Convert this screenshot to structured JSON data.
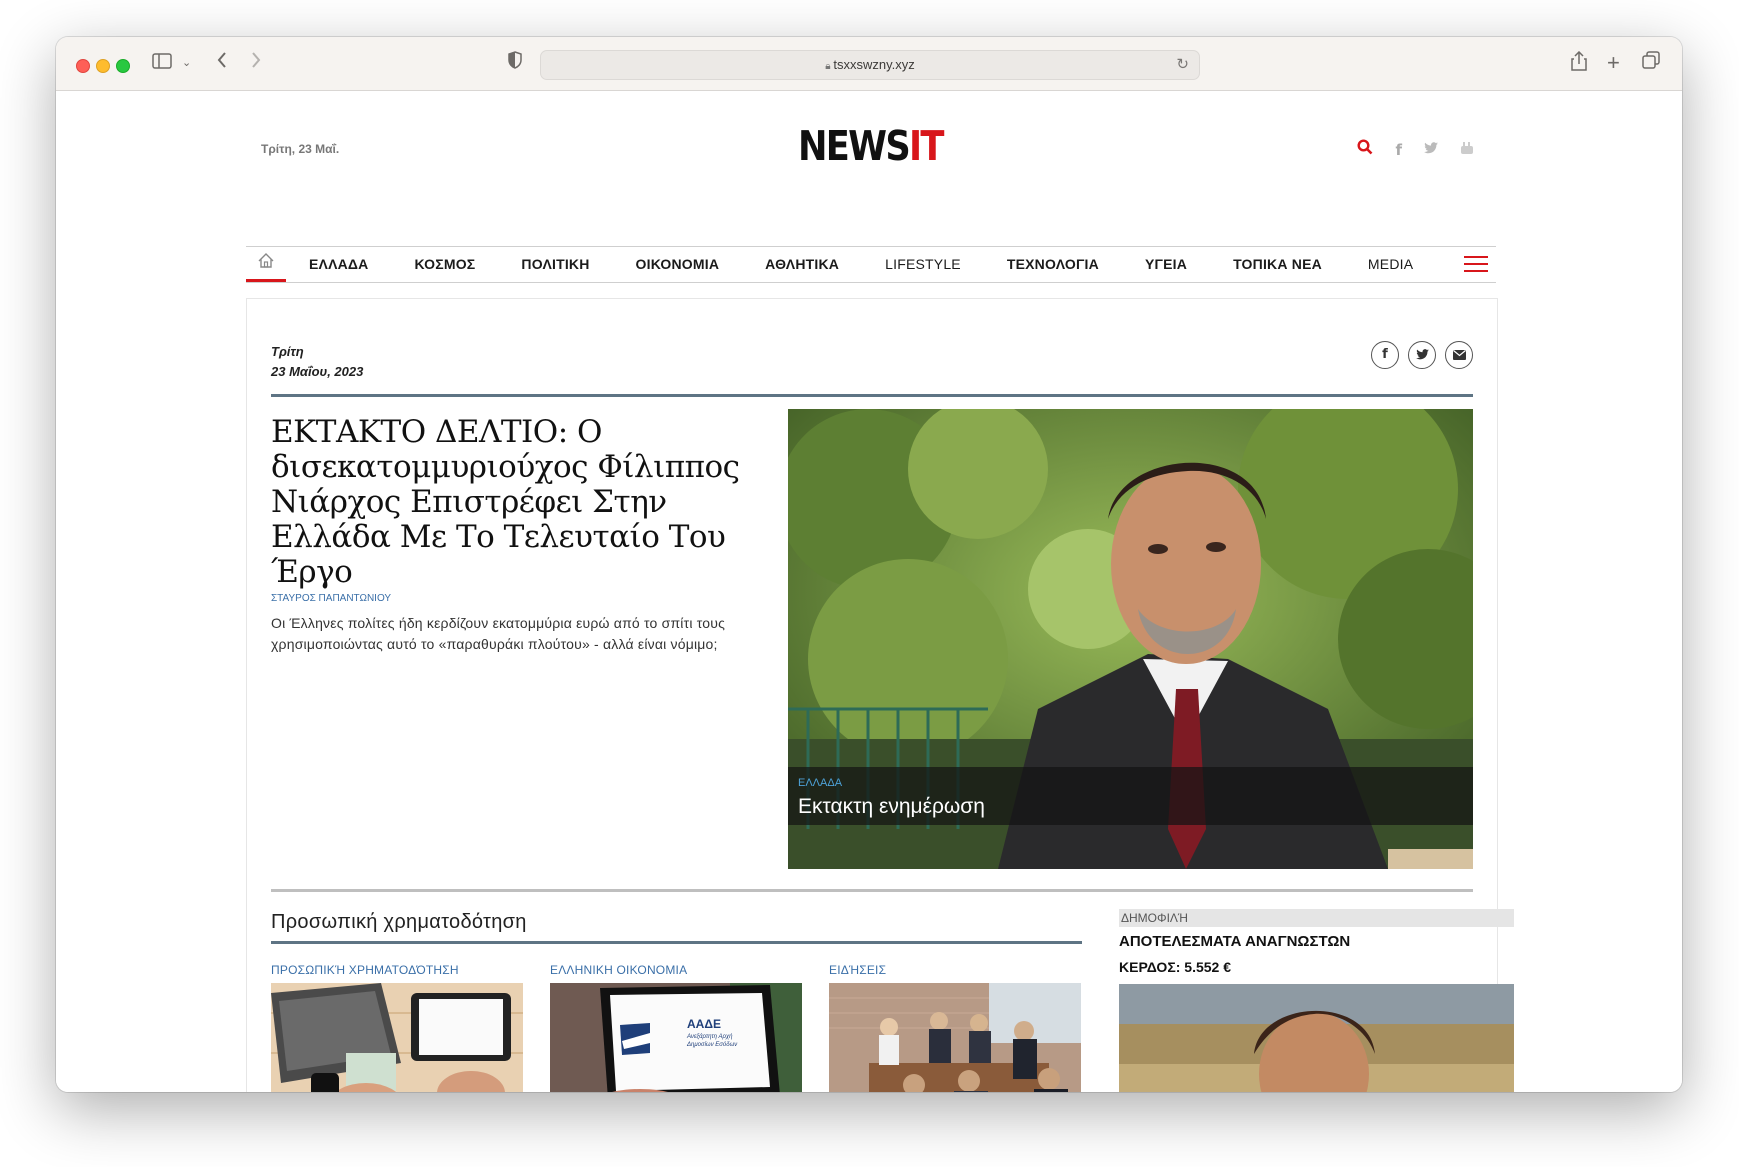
{
  "browser": {
    "url": "tsxxswzny.xyz"
  },
  "header": {
    "date": "Τρίτη, 23 Μαΐ.",
    "logo_news": "NEWS",
    "logo_it": "IT"
  },
  "nav": {
    "items": [
      "ΕΛΛΑΔΑ",
      "ΚΟΣΜΟΣ",
      "ΠΟΛΙΤΙΚΗ",
      "ΟΙΚΟΝΟΜΙΑ",
      "ΑΘΛΗΤΙΚΑ",
      "LIFESTYLE",
      "ΤΕΧΝΟΛΟΓΙΑ",
      "ΥΓΕΙΑ",
      "ΤΟΠΙΚΑ ΝΕΑ",
      "MEDIA"
    ]
  },
  "article": {
    "day": "Τρίτη",
    "date": "23 Μαΐου, 2023",
    "headline": "ΕΚΤΑΚΤΟ ΔΕΛΤΙΟ: Ο δισεκατομμυριούχος Φίλιππος Νιάρχος Επιστρέφει Στην Ελλάδα Με Το Τελευταίο Του Έργο",
    "author": "ΣΤΑΥΡΟΣ ΠΑΠΑΝΤΩΝΙΟΥ",
    "lead": "Οι Έλληνες πολίτες ήδη κερδίζουν εκατομμύρια ευρώ από το σπίτι τους χρησιμοποιώντας αυτό το «παραθυράκι πλούτου» - αλλά είναι νόμιμο;",
    "hero_category": "ΕΛΛΑΔΑ",
    "hero_caption": "Εκτακτη ενημέρωση"
  },
  "section": {
    "title": "Προσωπική χρηματοδότηση",
    "cards": [
      {
        "category": "ΠΡΟΣΩΠΙΚΉ ΧΡΗΜΑΤΟΔΌΤΗΣΗ"
      },
      {
        "category": "ΕΛΛΗΝΙΚΗ ΟΙΚΟΝΟΜΙΑ",
        "screen_title": "ΑΑΔΕ",
        "screen_sub": "Ανεξάρτητη Αρχή Δημοσίων Εσόδων"
      },
      {
        "category": "ΕΙΔΉΣΕΙΣ"
      }
    ]
  },
  "sidebar": {
    "label": "ΔΗΜΟΦΙΛΉ",
    "title": "ΑΠΟΤΕΛΕΣΜΑΤΑ ΑΝΑΓΝΩΣΤΩΝ",
    "subtitle": "ΚΕΡΔΟΣ: 5.552 €"
  },
  "colors": {
    "accent_red": "#d8161b",
    "link_blue": "#3a6fa8",
    "rule_slate": "#5e7484"
  }
}
